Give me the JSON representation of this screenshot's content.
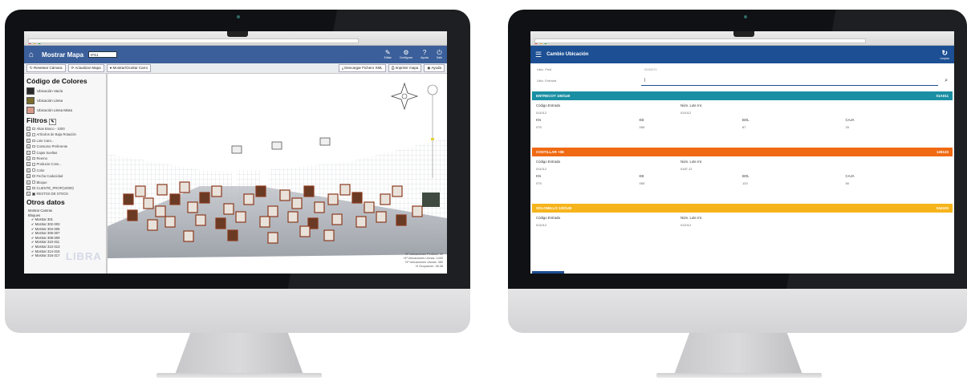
{
  "left": {
    "app_title": "Mostrar Mapa",
    "map_select": "IFS1",
    "header_icons": [
      {
        "name": "home-icon",
        "glyph": "⌂",
        "label": ""
      },
      {
        "name": "edit-icon",
        "glyph": "✎",
        "label": "Editar"
      },
      {
        "name": "settings-icon",
        "glyph": "⚙",
        "label": "Configurar"
      },
      {
        "name": "help-icon",
        "glyph": "?",
        "label": "Ayuda"
      },
      {
        "name": "power-icon",
        "glyph": "⏻",
        "label": "Salir"
      }
    ],
    "toolbar_left": [
      "↻ Resetear Cámara",
      "⟳ Actualizar Mapa",
      "● Mostrar/Ocultar Carro"
    ],
    "toolbar_right": [
      "⤓ Descargar Fichero XML",
      "⎙ Imprimir mapa",
      "◉ Ayuda"
    ],
    "legend_title": "Código de Colores",
    "legend": [
      {
        "label": "Ubicación Vacía",
        "color": "#2b2b2b"
      },
      {
        "label": "Ubicación Llena",
        "color": "#7a6d2d"
      },
      {
        "label": "Ubicación Llena Mixta",
        "color": "#d99a8a"
      }
    ],
    "filters_title": "Filtros",
    "filters": [
      "Altas Bosco - 1000",
      "Artículos de Baja Rotación",
      "Lote Caro...",
      "Consumo Preferente",
      "Cajas Sueltas",
      "Reemo",
      "Producto Cons...",
      "Color",
      "Fecha Caducidad",
      "Bloque",
      "CLIENTE_PROP(10000)",
      "RESTOS DE STOCK"
    ],
    "other_title": "Otros datos",
    "other_head": "Mostrar Camras",
    "other_sub": "Bloques",
    "other_items": [
      "Mostrar 301",
      "Mostrar 302-303",
      "Mostrar 304-305",
      "Mostrar 306-307",
      "Mostrar 308-309",
      "Mostrar 310-311",
      "Mostrar 312-313",
      "Mostrar 314-315",
      "Mostrar 316-317"
    ],
    "watermark": "LIBRA",
    "stats": [
      "Nº Ubicaciones Pedidos: 92",
      "Nº Ubicaciones Llenas: 1430",
      "Nº Ubicaciones Vacías: 380",
      "% Ocupación: 38.38"
    ]
  },
  "right": {
    "app_title": "Cambio Ubicación",
    "refresh_label": "Limpiar",
    "field_1_label": "Ubic. Pedi",
    "field_1_value": "0000070",
    "field_2_label": "Ubic. Entrada",
    "field_2_value": "|",
    "cards": [
      {
        "title": "ENTRECOT 100/140",
        "code": "01A011",
        "color": "#1a8fa3",
        "h1": "Código Entrada",
        "h2": "Núm. Lote Int.",
        "v1": "011012",
        "v2": "011012",
        "k": [
          "KN",
          "KB",
          "BOL",
          "CAJA"
        ],
        "kv": [
          "075",
          "065",
          "87",
          "25"
        ]
      },
      {
        "title": "COSTILLAR +08",
        "code": "128133",
        "color": "#f06a12",
        "h1": "Código Entrada",
        "h2": "Núm. Lote Int.",
        "v1": "011012",
        "v2": "0187.12",
        "k": [
          "KN",
          "KB",
          "BOL",
          "CAJA"
        ],
        "kv": [
          "075",
          "065",
          "120",
          "56"
        ]
      },
      {
        "title": "SOLOMILLO 120/140",
        "code": "044103",
        "color": "#f6b41c",
        "h1": "Código Entrada",
        "h2": "Núm. Lote Int.",
        "v1": "011012",
        "v2": "011012",
        "k": [],
        "kv": []
      }
    ]
  }
}
